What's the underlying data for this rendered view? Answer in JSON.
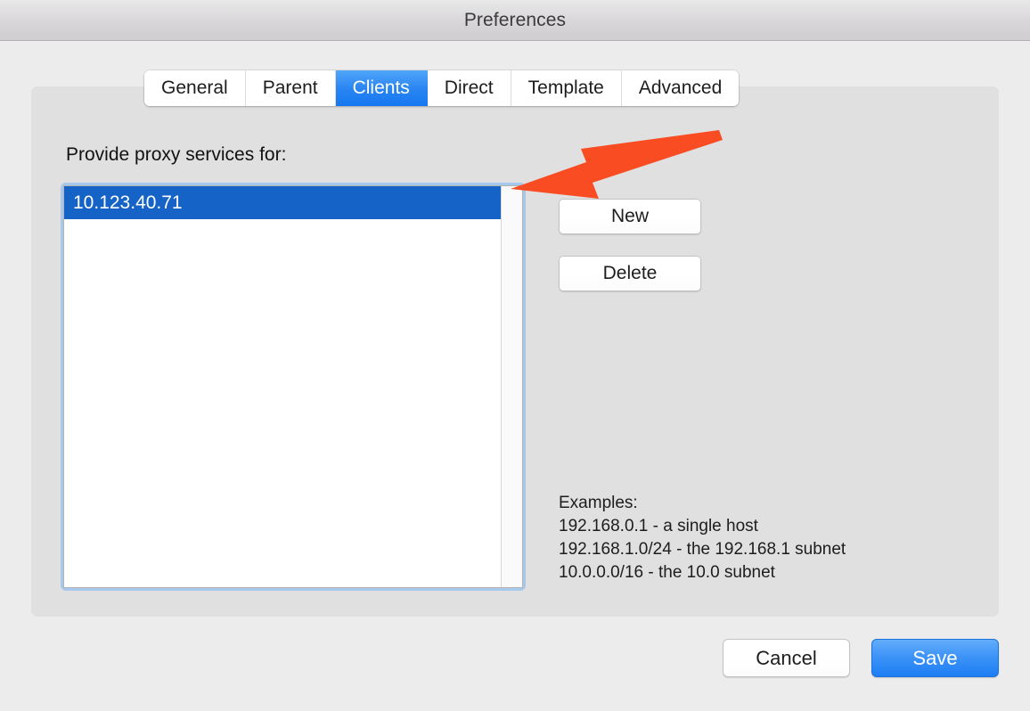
{
  "window": {
    "title": "Preferences"
  },
  "tabs": [
    {
      "label": "General",
      "active": false
    },
    {
      "label": "Parent",
      "active": false
    },
    {
      "label": "Clients",
      "active": true
    },
    {
      "label": "Direct",
      "active": false
    },
    {
      "label": "Template",
      "active": false
    },
    {
      "label": "Advanced",
      "active": false
    }
  ],
  "clients_pane": {
    "section_label": "Provide proxy services for:",
    "list": {
      "items": [
        {
          "value": "10.123.40.71",
          "selected": true
        }
      ],
      "scrollbar": "vertical-scrollbar"
    },
    "buttons": {
      "new_label": "New",
      "delete_label": "Delete"
    },
    "examples": {
      "heading": "Examples:",
      "lines": [
        "192.168.0.1 - a single host",
        "192.168.1.0/24 - the 192.168.1 subnet",
        "10.0.0.0/16 - the 10.0 subnet"
      ]
    }
  },
  "footer": {
    "cancel_label": "Cancel",
    "save_label": "Save"
  },
  "annotation": {
    "type": "red-arrow",
    "points_to": "clients-list-box",
    "color": "#f94c22"
  },
  "colors": {
    "window_background": "#ececec",
    "panel_background": "#e0e0e0",
    "titlebar_top": "#e9e8e9",
    "titlebar_bottom": "#cfcdcf",
    "tab_active": "#2b86f2",
    "selection_blue": "#1563c6",
    "focus_ring": "#a7c8ee",
    "save_button_blue": "#3e94f7",
    "annotation_red": "#f94c22"
  }
}
